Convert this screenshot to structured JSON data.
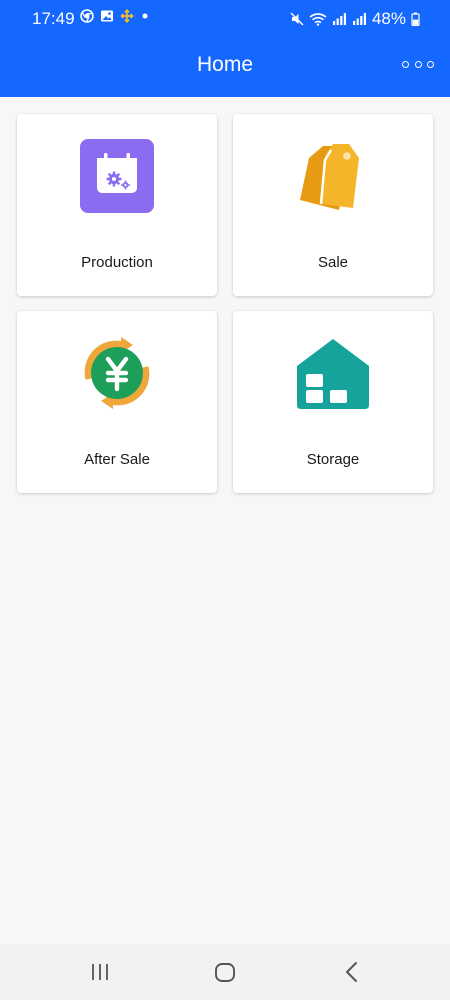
{
  "status_bar": {
    "time": "17:49",
    "battery_percent": "48%",
    "left_icons": [
      "chrome-icon",
      "gallery-icon",
      "binance-icon",
      "notification-dot-icon"
    ],
    "right_icons": [
      "mute-icon",
      "wifi-icon",
      "signal-icon",
      "signal-icon",
      "battery-icon"
    ]
  },
  "header": {
    "title": "Home",
    "menu_icon": "more-horizontal-icon"
  },
  "tiles": [
    {
      "label": "Production",
      "icon": "production-calendar-gear-icon",
      "color": "#8b6cf0"
    },
    {
      "label": "Sale",
      "icon": "sale-tag-icon",
      "color": "#f2ad25"
    },
    {
      "label": "After Sale",
      "icon": "after-sale-yen-icon",
      "color": "#1d9e59"
    },
    {
      "label": "Storage",
      "icon": "storage-house-icon",
      "color": "#16a39c"
    }
  ],
  "nav_bar": {
    "buttons": [
      "recent-apps-icon",
      "home-icon",
      "back-icon"
    ]
  },
  "colors": {
    "header": "#1467ff",
    "background": "#f7f7f9"
  }
}
